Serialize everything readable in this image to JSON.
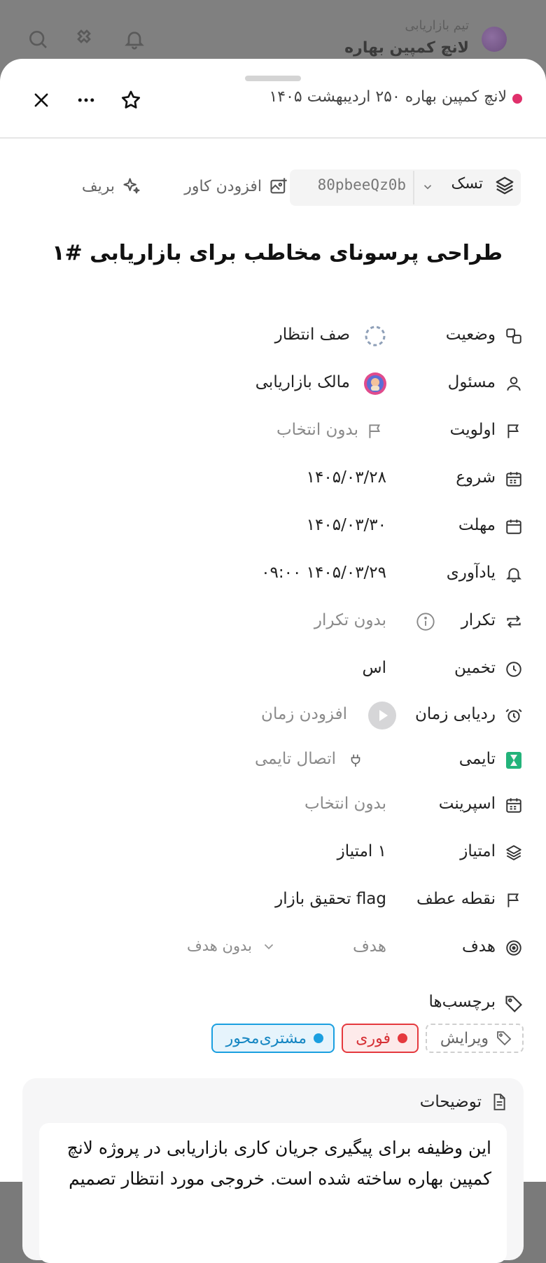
{
  "background": {
    "subtitle": "تیم بازاریابی",
    "title": "لانچ کمپین بهاره"
  },
  "breadcrumb": {
    "text": "لانچ کمپین بهاره ۲۵۰ اردیبهشت ۱۴۰۵",
    "dot_color": "#e0306b"
  },
  "toolbar": {
    "type_label": "تسک",
    "task_id": "80pbeeQz0b",
    "cover_label": "افزودن کاور",
    "brief_label": "بریف"
  },
  "task": {
    "title": "طراحی پرسونای مخاطب برای بازاریابی #۱"
  },
  "properties": {
    "status": {
      "label": "وضعیت",
      "value": "صف انتظار"
    },
    "assignee": {
      "label": "مسئول",
      "value": "مالک بازاریابی"
    },
    "priority": {
      "label": "اولویت",
      "value": "بدون انتخاب"
    },
    "start": {
      "label": "شروع",
      "value": "۱۴۰۵/۰۳/۲۸"
    },
    "due": {
      "label": "مهلت",
      "value": "۱۴۰۵/۰۳/۳۰"
    },
    "reminder": {
      "label": "یادآوری",
      "value": "۱۴۰۵/۰۳/۲۹ ۰۹:۰۰"
    },
    "repeat": {
      "label": "تکرار",
      "value": "بدون تکرار"
    },
    "estimate": {
      "label": "تخمین",
      "value": "اس"
    },
    "time_tracking": {
      "label": "ردیابی زمان",
      "value": "افزودن زمان"
    },
    "timer": {
      "label": "تایمی",
      "value": "اتصال تایمی"
    },
    "sprint": {
      "label": "اسپرینت",
      "value": "بدون انتخاب"
    },
    "points": {
      "label": "امتیاز",
      "value": "۱ امتیاز"
    },
    "milestone": {
      "label": "نقطه عطف",
      "value": "flag تحقیق بازار"
    },
    "goal": {
      "label": "هدف",
      "value": "هدف",
      "select": "بدون هدف"
    }
  },
  "tags": {
    "label": "برچسب‌ها",
    "edit_label": "ویرایش",
    "items": [
      {
        "name": "فوری",
        "color": "#e5393e"
      },
      {
        "name": "مشتری‌محور",
        "color": "#1a9fe0"
      }
    ]
  },
  "description": {
    "label": "توضیحات",
    "text": "این وظیفه برای پیگیری جریان کاری بازاریابی در پروژه لانچ کمپین بهاره ساخته شده است. خروجی مورد انتظار تصمیم"
  }
}
